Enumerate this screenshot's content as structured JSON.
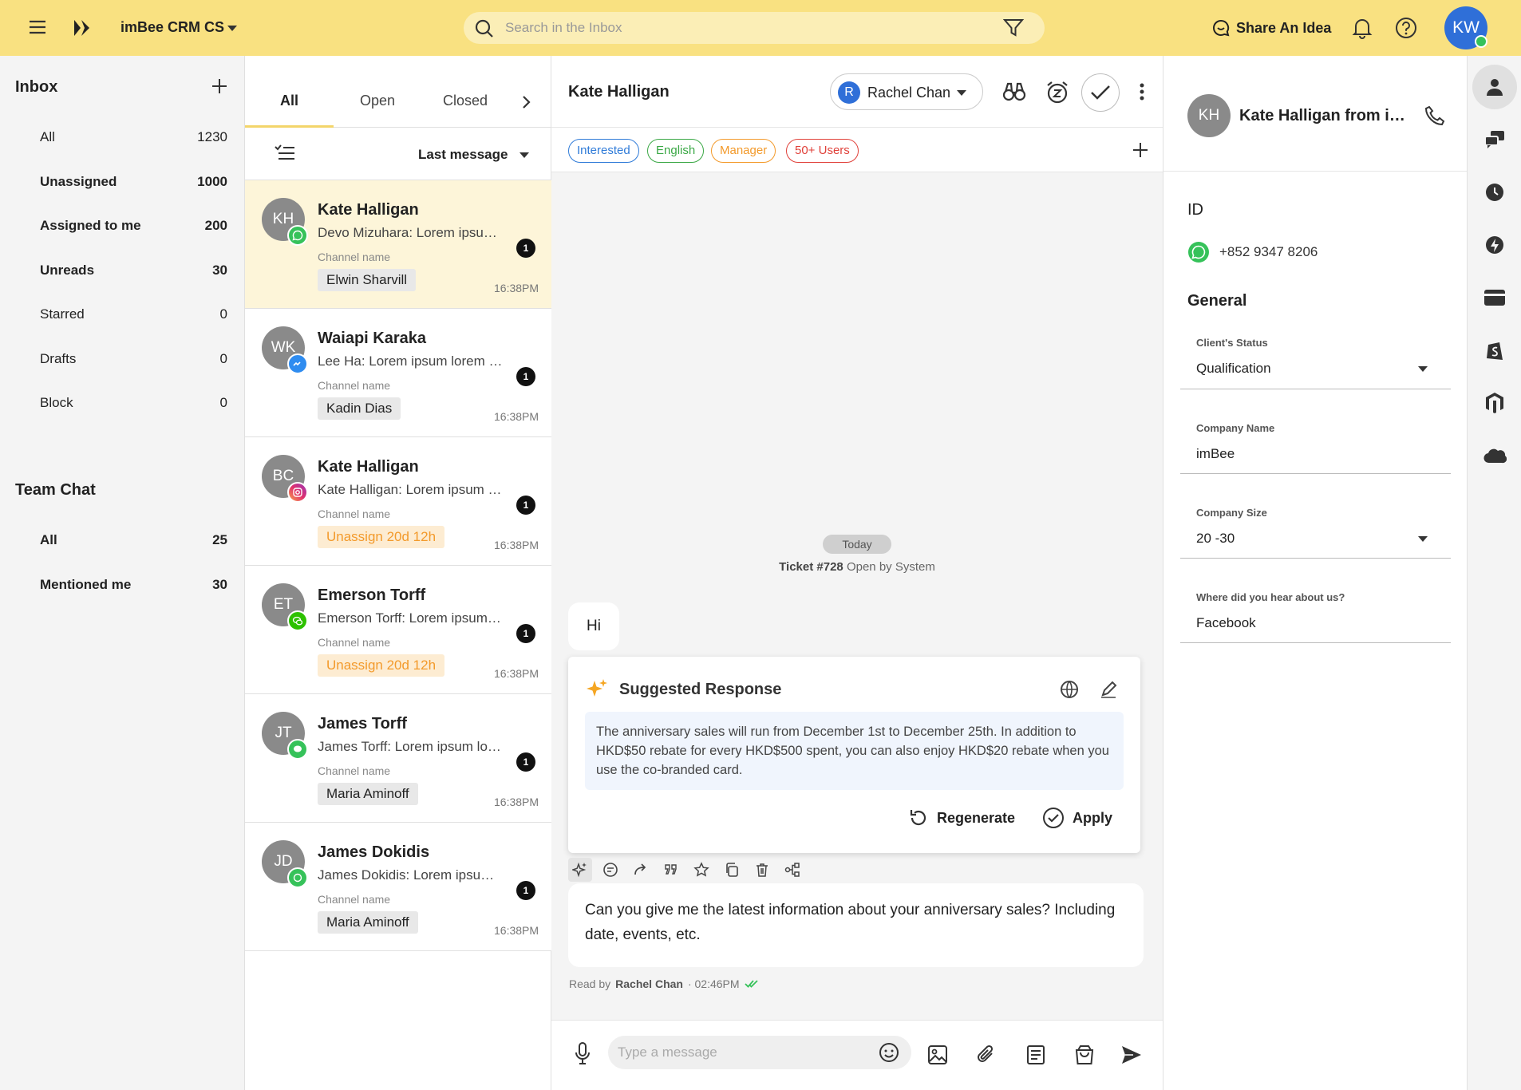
{
  "app": {
    "title": "imBee CRM CS"
  },
  "search": {
    "placeholder": "Search in the Inbox"
  },
  "topbar": {
    "share_label": "Share An Idea",
    "user_initials": "KW"
  },
  "sidebar": {
    "inbox_title": "Inbox",
    "inbox_items": [
      {
        "label": "All",
        "count": "1230"
      },
      {
        "label": "Unassigned",
        "count": "1000"
      },
      {
        "label": "Assigned to me",
        "count": "200"
      },
      {
        "label": "Unreads",
        "count": "30"
      },
      {
        "label": "Starred",
        "count": "0"
      },
      {
        "label": "Drafts",
        "count": "0"
      },
      {
        "label": "Block",
        "count": "0"
      }
    ],
    "team_title": "Team Chat",
    "team_items": [
      {
        "label": "All",
        "count": "25"
      },
      {
        "label": "Mentioned me",
        "count": "30"
      }
    ]
  },
  "list": {
    "tabs": [
      "All",
      "Open",
      "Closed"
    ],
    "sort_label": "Last message",
    "conversations": [
      {
        "initials": "KH",
        "name": "Kate Halligan",
        "preview": "Devo Mizuhara: Lorem ipsum lorem ipsum",
        "channel": "Channel name",
        "tag": "Elwin Sharvill",
        "badge": "1",
        "time": "16:38PM",
        "channel_icon": "whatsapp-icon"
      },
      {
        "initials": "WK",
        "name": "Waiapi Karaka",
        "preview": "Lee Ha: Lorem ipsum lorem ipsum",
        "channel": "Channel name",
        "tag": "Kadin Dias",
        "badge": "1",
        "time": "16:38PM",
        "channel_icon": "messenger-icon"
      },
      {
        "initials": "BC",
        "name": "Kate Halligan",
        "preview": "Kate Halligan: Lorem ipsum lorem",
        "channel": "Channel name",
        "tag": "Unassign 20d 12h",
        "badge": "1",
        "time": "16:38PM",
        "channel_icon": "instagram-icon"
      },
      {
        "initials": "ET",
        "name": "Emerson Torff",
        "preview": "Emerson Torff: Lorem ipsum lorem",
        "channel": "Channel name",
        "tag": "Unassign 20d 12h",
        "badge": "1",
        "time": "16:38PM",
        "channel_icon": "wechat-icon"
      },
      {
        "initials": "JT",
        "name": "James Torff",
        "preview": "James Torff: Lorem ipsum lorem",
        "channel": "Channel name",
        "tag": "Maria Aminoff",
        "badge": "1",
        "time": "16:38PM",
        "channel_icon": "line-icon"
      },
      {
        "initials": "JD",
        "name": "James Dokidis",
        "preview": "James Dokidis: Lorem ipsum lorem",
        "channel": "Channel name",
        "tag": "Maria Aminoff",
        "badge": "1",
        "time": "16:38PM",
        "channel_icon": "wechat-icon"
      }
    ]
  },
  "chat": {
    "title": "Kate Halligan",
    "assignee": {
      "initial": "R",
      "name": "Rachel Chan"
    },
    "tags": [
      {
        "label": "Interested",
        "color": "#2f7bd8"
      },
      {
        "label": "English",
        "color": "#3aa845"
      },
      {
        "label": "Manager",
        "color": "#f39a2b"
      },
      {
        "label": "50+ Users",
        "color": "#e0413a"
      }
    ],
    "date_pill": "Today",
    "ticket": {
      "number": "Ticket #728",
      "rest": "Open by System"
    },
    "greeting": "Hi",
    "suggested": {
      "title": "Suggested Response",
      "body": "The anniversary sales will run from December 1st to December 25th. In addition to HKD$50 rebate for every HKD$500 spent, you can also enjoy HKD$20 rebate when you use the co-branded card.",
      "regenerate": "Regenerate",
      "apply": "Apply"
    },
    "customer_message": "Can you give me the latest information about your anniversary sales? Including date, events, etc.",
    "read_by": {
      "prefix": "Read by",
      "name": "Rachel Chan",
      "time": "· 02:46PM"
    },
    "composer_placeholder": "Type a message"
  },
  "panel": {
    "initials": "KH",
    "name": "Kate Halligan from imBee",
    "id_title": "ID",
    "phone": "+852 9347 8206",
    "general_title": "General",
    "fields": [
      {
        "label": "Client's Status",
        "value": "Qualification",
        "dropdown": true
      },
      {
        "label": "Company Name",
        "value": "imBee",
        "dropdown": false
      },
      {
        "label": "Company Size",
        "value": "20 -30",
        "dropdown": true
      },
      {
        "label": "Where did you hear about us?",
        "value": "Facebook",
        "dropdown": false
      }
    ]
  },
  "colors": {
    "topbar": "#f9e181",
    "accent": "#f3d56a",
    "selected_row": "#fdf5d9",
    "warn": "#f39a2b",
    "whatsapp": "#36c25a"
  }
}
